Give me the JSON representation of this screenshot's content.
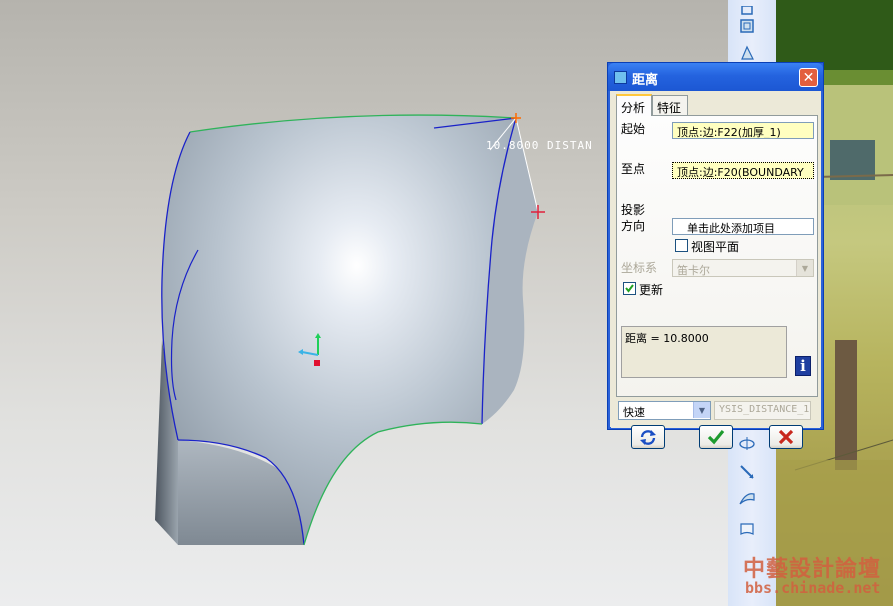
{
  "dialog": {
    "title": "距离",
    "close_label": "✕",
    "tabs": [
      {
        "label": "分析"
      },
      {
        "label": "特征"
      }
    ],
    "from": {
      "label": "起始",
      "value": "顶点:边:F22(加厚_1)"
    },
    "to": {
      "label": "至点",
      "value": "顶点:边:F20(BOUNDARY"
    },
    "projection": {
      "label_line1": "投影",
      "label_line2": "方向",
      "value": "单击此处添加项目"
    },
    "view_plane": {
      "label": "视图平面",
      "checked": false
    },
    "coord_system": {
      "label": "坐标系",
      "value": "笛卡尔"
    },
    "update": {
      "label": "更新",
      "checked": true
    },
    "result": "距离  = 10.8000",
    "mode": {
      "value": "快速",
      "name_value": "YSIS_DISTANCE_1"
    },
    "buttons": {
      "repeat": "repeat-icon",
      "ok": "check-icon",
      "cancel": "x-icon"
    }
  },
  "viewport": {
    "dimension_label": "10.8000  DISTAN"
  },
  "watermark": {
    "title": "中藝設計論壇",
    "url": "bbs.chinade.net"
  },
  "colors": {
    "titlebar": "#2463df",
    "edge_blue": "#1a22c8",
    "edge_green": "#2fb35a",
    "ok_green": "#1e9b2f",
    "cancel_red": "#c8281e"
  }
}
